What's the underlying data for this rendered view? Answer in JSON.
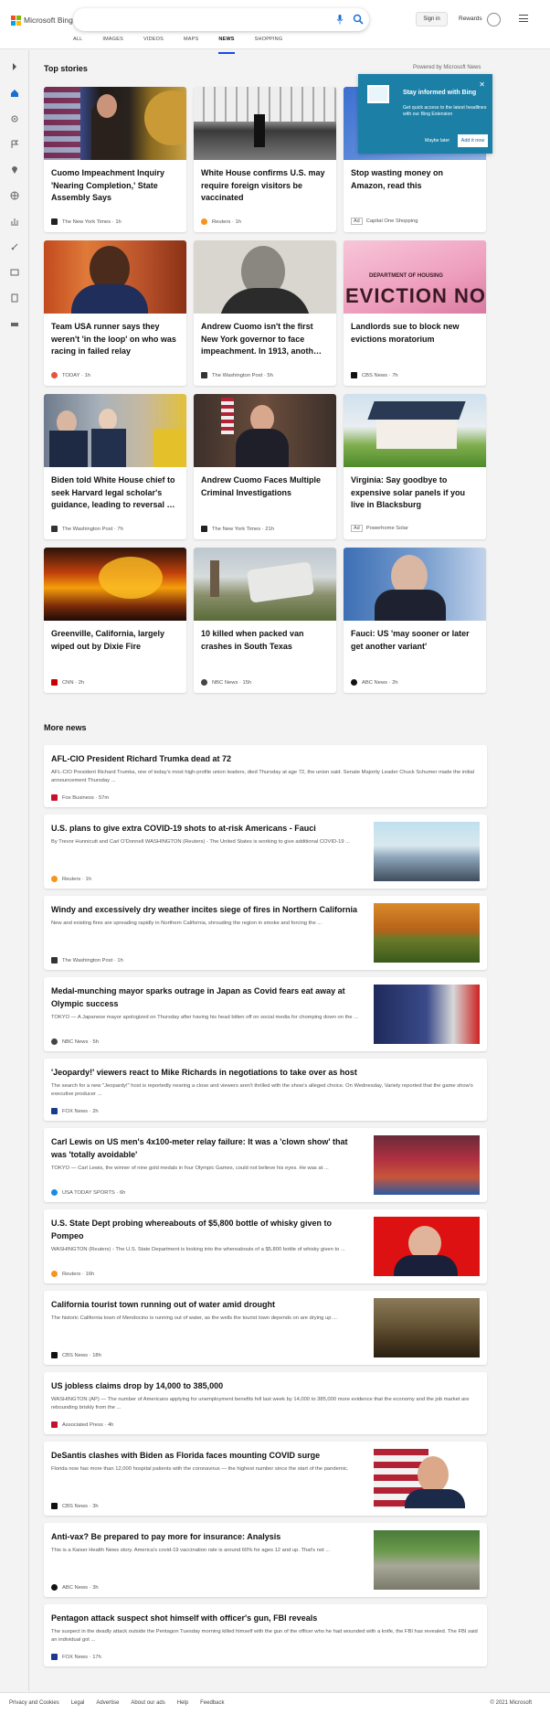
{
  "header": {
    "brand": "Microsoft Bing",
    "search_placeholder": "",
    "sign_in": "Sign in",
    "rewards": "Rewards",
    "nav": [
      "ALL",
      "IMAGES",
      "VIDEOS",
      "MAPS",
      "NEWS",
      "SHOPPING"
    ],
    "active_nav": "NEWS"
  },
  "top_stories": {
    "heading": "Top stories",
    "powered_by": "Powered by Microsoft News",
    "cards": [
      {
        "title": "Cuomo Impeachment Inquiry 'Nearing Completion,' State Assembly Says",
        "source": "The New York Times",
        "time": "1h"
      },
      {
        "title": "White House confirms U.S. may require foreign visitors be vaccinated",
        "source": "Reuters",
        "time": "1h"
      },
      {
        "title": "Stop wasting money on Amazon, read this",
        "source": "Capital One Shopping",
        "ad": "Ad"
      },
      {
        "title": "Team USA runner says they weren't 'in the loop' on who was racing in failed relay",
        "source": "TODAY",
        "time": "1h"
      },
      {
        "title": "Andrew Cuomo isn't the first New York governor to face impeachment. In 1913, anoth…",
        "source": "The Washington Post",
        "time": "5h"
      },
      {
        "title": "Landlords sue to block new evictions moratorium",
        "source": "CBS News",
        "time": "7h",
        "image_text": "DEPARTMENT OF HOUSING",
        "image_text2": "EVICTION NOTIC"
      },
      {
        "title": "Biden told White House chief to seek Harvard legal scholar's guidance, leading to reversal …",
        "source": "The Washington Post",
        "time": "7h"
      },
      {
        "title": "Andrew Cuomo Faces Multiple Criminal Investigations",
        "source": "The New York Times",
        "time": "21h"
      },
      {
        "title": "Virginia: Say goodbye to expensive solar panels if you live in Blacksburg",
        "source": "Powerhome Solar",
        "ad": "Ad"
      },
      {
        "title": "Greenville, California, largely wiped out by Dixie Fire",
        "source": "CNN",
        "time": "2h"
      },
      {
        "title": "10 killed when packed van crashes in South Texas",
        "source": "NBC News",
        "time": "15h"
      },
      {
        "title": "Fauci: US 'may sooner or later get another variant'",
        "source": "ABC News",
        "time": "2h"
      }
    ]
  },
  "promo": {
    "title": "Stay informed with Bing",
    "body": "Get quick access to the latest headlines with our Bing Extension",
    "maybe_later": "Maybe later",
    "add_now": "Add it now",
    "close": "✕"
  },
  "more_news": {
    "heading": "More news",
    "items": [
      {
        "title": "AFL-CIO President Richard Trumka dead at 72",
        "summary": "AFL-CIO President Richard Trumka, one of today's most high-profile union leaders, died Thursday at age 72, the union said. Senate Majority Leader Chuck Schumer made the initial announcement Thursday ...",
        "source": "Fox Business",
        "time": "57m"
      },
      {
        "title": "U.S. plans to give extra COVID-19 shots to at-risk Americans - Fauci",
        "summary": "By Trevor Hunnicutt and Carl O'Donnell WASHINGTON (Reuters) - The United States is working to give additional COVID-19 ...",
        "source": "Reuters",
        "time": "1h"
      },
      {
        "title": "Windy and excessively dry weather incites siege of fires in Northern California",
        "summary": "New and existing fires are spreading rapidly in Northern California, shrouding the region in smoke and forcing the ...",
        "source": "The Washington Post",
        "time": "1h"
      },
      {
        "title": "Medal-munching mayor sparks outrage in Japan as Covid fears eat away at Olympic success",
        "summary": "TOKYO — A Japanese mayor apologized on Thursday after having his head bitten off on social media for chomping down on the ...",
        "source": "NBC News",
        "time": "5h"
      },
      {
        "title": "'Jeopardy!' viewers react to Mike Richards in negotiations to take over as host",
        "summary": "The search for a new \"Jeopardy!\" host is reportedly nearing a close and viewers aren't thrilled with the show's alleged choice. On Wednesday, Variety reported that the game show's executive producer ...",
        "source": "FOX News",
        "time": "2h"
      },
      {
        "title": "Carl Lewis on US men's 4x100-meter relay failure: It was a 'clown show' that was 'totally avoidable'",
        "summary": "TOKYO — Carl Lewis, the winner of nine gold medals in four Olympic Games, could not believe his eyes. He was at ...",
        "source": "USA TODAY SPORTS",
        "time": "6h"
      },
      {
        "title": "U.S. State Dept probing whereabouts of $5,800 bottle of whisky given to Pompeo",
        "summary": "WASHINGTON (Reuters) - The U.S. State Department is looking into the whereabouts of a $5,800 bottle of whisky given to ...",
        "source": "Reuters",
        "time": "16h"
      },
      {
        "title": "California tourist town running out of water amid drought",
        "summary": "The historic California town of Mendocino is running out of water, as the wells the tourist town depends on are drying up ...",
        "source": "CBS News",
        "time": "18h"
      },
      {
        "title": "US jobless claims drop by 14,000 to 385,000",
        "summary": "WASHINGTON (AP) — The number of Americans applying for unemployment benefits fell last week by 14,000 to 385,000 more evidence that the economy and the job market are rebounding briskly from the ...",
        "source": "Associated Press",
        "time": "4h"
      },
      {
        "title": "DeSantis clashes with Biden as Florida faces mounting COVID surge",
        "summary": "Florida now has more than 12,000 hospital patients with the coronavirus — the highest number since the start of the pandemic.",
        "source": "CBS News",
        "time": "3h"
      },
      {
        "title": "Anti-vax? Be prepared to pay more for insurance: Analysis",
        "summary": "This is a Kaiser Health News story. America's covid-19 vaccination rate is around 60% for ages 12 and up. That's not ...",
        "source": "ABC News",
        "time": "3h"
      },
      {
        "title": "Pentagon attack suspect shot himself with officer's gun, FBI reveals",
        "summary": "The suspect in the deadly attack outside the Pentagon Tuesday morning killed himself with the gun of the officer who he had wounded with a knife, the FBI has revealed. The FBI said an individual got ...",
        "source": "FOX News",
        "time": "17h"
      }
    ]
  },
  "footer": {
    "links": [
      "Privacy and Cookies",
      "Legal",
      "Advertise",
      "About our ads",
      "Help",
      "Feedback"
    ],
    "copyright": "© 2021 Microsoft"
  },
  "colors": {
    "accent": "#174ae4",
    "promo": "#1b7fa6",
    "background": "#f3f3f3"
  }
}
